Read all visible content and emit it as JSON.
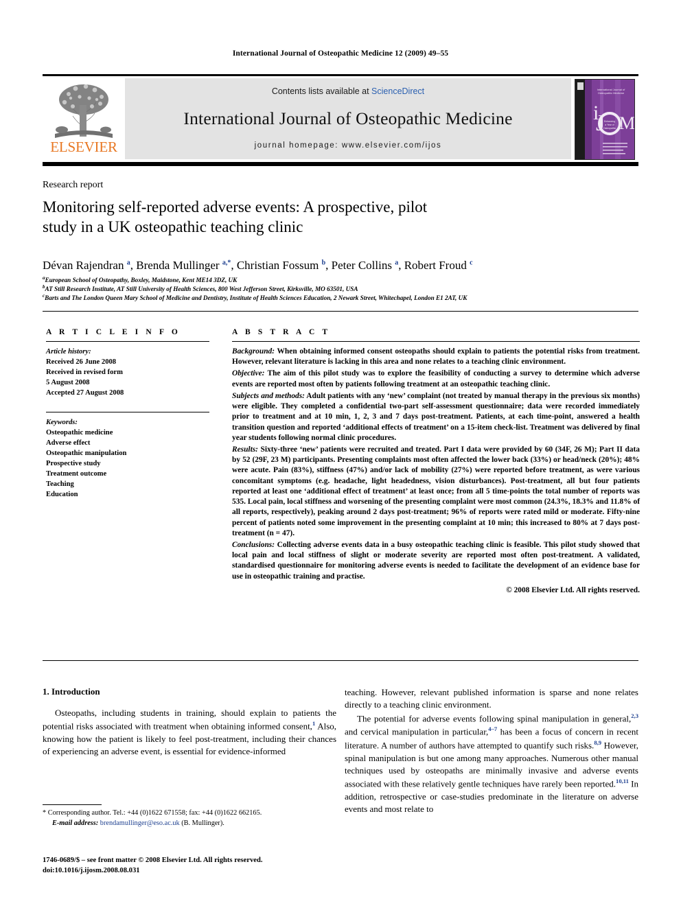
{
  "running_head": "International Journal of Osteopathic Medicine 12 (2009) 49–55",
  "masthead": {
    "contents_prefix": "Contents lists available at ",
    "sciencedirect": "ScienceDirect",
    "journal_title": "International Journal of Osteopathic Medicine",
    "homepage": "journal homepage: www.elsevier.com/ijos",
    "publisher_wordmark": "ELSEVIER",
    "publisher_color": "#E87722",
    "link_color": "#2b60b0",
    "band_color": "#e3e3e3",
    "cover_accent": "#7d3f98",
    "cover_label_i": "i",
    "cover_label_j": "J",
    "cover_label_o": "O",
    "cover_label_m": "M"
  },
  "article": {
    "kicker": "Research report",
    "title_line1": "Monitoring self-reported adverse events: A prospective, pilot",
    "title_line2": "study in a UK osteopathic teaching clinic",
    "authors_html": "Dévan Rajendran <sup>a</sup>, Brenda Mullinger <sup>a,*</sup>, Christian Fossum <sup>b</sup>, Peter Collins <sup>a</sup>, Robert Froud <sup>c</sup>",
    "affiliations": [
      "European School of Osteopathy, Boxley, Maidstone, Kent ME14 3DZ, UK",
      "AT Still Research Institute, AT Still University of Health Sciences, 800 West Jefferson Street, Kirksville, MO 63501, USA",
      "Barts and The London Queen Mary School of Medicine and Dentistry, Institute of Health Sciences Education, 2 Newark Street, Whitechapel, London E1 2AT, UK"
    ],
    "affiliation_marks": [
      "a",
      "b",
      "c"
    ]
  },
  "info": {
    "heading": "A R T I C L E   I N F O",
    "history_label": "Article history:",
    "history_lines": [
      "Received 26 June 2008",
      "Received in revised form",
      "5 August 2008",
      "Accepted 27 August 2008"
    ],
    "keywords_label": "Keywords:",
    "keywords": [
      "Osteopathic medicine",
      "Adverse effect",
      "Osteopathic manipulation",
      "Prospective study",
      "Treatment outcome",
      "Teaching",
      "Education"
    ]
  },
  "abstract": {
    "heading": "A B S T R A C T",
    "background_label": "Background:",
    "background_text": " When obtaining informed consent osteopaths should explain to patients the potential risks from treatment. However, relevant literature is lacking in this area and none relates to a teaching clinic environment.",
    "objective_label": "Objective:",
    "objective_text": " The aim of this pilot study was to explore the feasibility of conducting a survey to determine which adverse events are reported most often by patients following treatment at an osteopathic teaching clinic.",
    "methods_label": "Subjects and methods:",
    "methods_text": " Adult patients with any ‘new’ complaint (not treated by manual therapy in the previous six months) were eligible. They completed a confidential two-part self-assessment questionnaire; data were recorded immediately prior to treatment and at 10 min, 1, 2, 3 and 7 days post-treatment. Patients, at each time-point, answered a health transition question and reported ‘additional effects of treatment’ on a 15-item check-list. Treatment was delivered by final year students following normal clinic procedures.",
    "results_label": "Results:",
    "results_text": " Sixty-three ‘new’ patients were recruited and treated. Part I data were provided by 60 (34F, 26 M); Part II data by 52 (29F, 23 M) participants. Presenting complaints most often affected the lower back (33%) or head/neck (20%); 48% were acute. Pain (83%), stiffness (47%) and/or lack of mobility (27%) were reported before treatment, as were various concomitant symptoms (e.g. headache, light headedness, vision disturbances). Post-treatment, all but four patients reported at least one ‘additional effect of treatment’ at least once; from all 5 time-points the total number of reports was 535. Local pain, local stiffness and worsening of the presenting complaint were most common (24.3%, 18.3% and 11.8% of all reports, respectively), peaking around 2 days post-treatment; 96% of reports were rated mild or moderate. Fifty-nine percent of patients noted some improvement in the presenting complaint at 10 min; this increased to 80% at 7 days post-treatment (n = 47).",
    "conclusions_label": "Conclusions:",
    "conclusions_text": " Collecting adverse events data in a busy osteopathic teaching clinic is feasible. This pilot study showed that local pain and local stiffness of slight or moderate severity are reported most often post-treatment. A validated, standardised questionnaire for monitoring adverse events is needed to facilitate the development of an evidence base for use in osteopathic training and practise.",
    "copyright": "© 2008 Elsevier Ltd. All rights reserved."
  },
  "body": {
    "section_heading": "1. Introduction",
    "left_para_1_a": "Osteopaths, including students in training, should explain to patients the potential risks associated with treatment when obtaining informed consent,",
    "left_para_1_sup": "1",
    "left_para_1_b": " Also, knowing how the patient is likely to feel post-treatment, including their chances of experiencing an adverse event, is essential for evidence-informed",
    "right_para_1_cont": "teaching. However, relevant published information is sparse and none relates directly to a teaching clinic environment.",
    "right_para_2_a": "The potential for adverse events following spinal manipulation in general,",
    "right_para_2_sup1": "2,3",
    "right_para_2_b": " and cervical manipulation in particular,",
    "right_para_2_sup2": "4–7",
    "right_para_2_c": " has been a focus of concern in recent literature. A number of authors have attempted to quantify such risks.",
    "right_para_2_sup3": "8,9",
    "right_para_2_d": " However, spinal manipulation is but one among many approaches. Numerous other manual techniques used by osteopaths are minimally invasive and adverse events associated with these relatively gentle techniques have rarely been reported.",
    "right_para_2_sup4": "10,11",
    "right_para_2_e": " In addition, retrospective or case-studies predominate in the literature on adverse events and most relate to"
  },
  "footer": {
    "corresponding_mark": "*",
    "corresponding_text": " Corresponding author. Tel.: +44 (0)1622 671558; fax: +44 (0)1622 662165.",
    "email_label": "E-mail address:",
    "email": "brendamullinger@eso.ac.uk",
    "email_owner": " (B. Mullinger).",
    "issn_line": "1746-0689/$ – see front matter © 2008 Elsevier Ltd. All rights reserved.",
    "doi_line": "doi:10.1016/j.ijosm.2008.08.031"
  }
}
